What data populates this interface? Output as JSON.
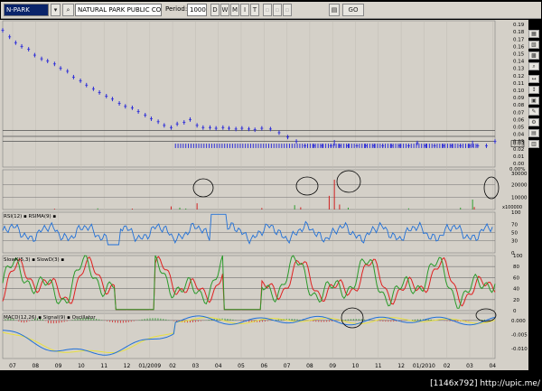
{
  "toolbar": {
    "ticker": "N-PARK",
    "company": "NATURAL PARK PUBLIC CO.",
    "period_label": "Period:",
    "period_value": "1000",
    "tf_buttons": [
      "D",
      "W",
      "M",
      "I",
      "T"
    ],
    "go_label": "GO"
  },
  "colors": {
    "background": "#d4d0c8",
    "price": "#2a2ad8",
    "grid": "#505050",
    "volume": "#2e9e2e",
    "volume_alt": "#d02020",
    "rsi": "#2070d8",
    "stoch_k": "#2a9a2a",
    "stoch_d": "#e02020",
    "macd": "#2070d8",
    "signal": "#e8e040",
    "osc_pos": "#3ea03e",
    "osc_neg": "#d04040"
  },
  "credit": "[1146x792] http://upic.me/",
  "chart_data": [
    {
      "type": "line",
      "subtype": "ohlc",
      "panel": "price",
      "y_ticks": [
        0.19,
        0.18,
        0.17,
        0.16,
        0.15,
        0.14,
        0.13,
        0.12,
        0.11,
        0.1,
        0.09,
        0.08,
        0.07,
        0.06,
        0.05,
        0.04,
        0.03,
        0.02,
        0.01,
        0.0
      ],
      "y_tick_labels": [
        "0.19",
        "0.18",
        "0.17",
        "0.16",
        "0.15",
        "0.14",
        "0.13",
        "0.12",
        "0.11",
        "0.10",
        "0.09",
        "0.08",
        "0.07",
        "0.06",
        "0.05",
        "0.04",
        "0.03",
        "0.02",
        "0.01",
        "0.00"
      ],
      "last_label": "0.03",
      "pct_label": "0.00%",
      "ylim": [
        -0.005,
        0.195
      ],
      "horizontal_lines": [
        0.045,
        0.037,
        0.03
      ],
      "x": [
        0,
        8,
        15,
        22,
        30,
        37,
        45,
        52,
        60,
        67,
        75,
        82,
        90,
        97,
        105,
        112,
        120,
        127,
        135,
        142,
        150,
        157,
        165,
        172,
        180,
        187,
        195,
        202,
        210,
        217,
        225,
        232,
        240,
        247,
        255,
        262,
        270,
        277,
        285,
        292,
        300,
        310,
        320,
        330,
        340,
        350,
        360,
        370,
        380,
        390,
        400,
        410,
        420,
        430,
        440,
        450,
        460,
        470,
        480,
        490,
        500,
        510,
        520,
        530,
        540,
        550,
        560,
        570
      ],
      "close": [
        0.182,
        0.173,
        0.165,
        0.16,
        0.156,
        0.148,
        0.143,
        0.14,
        0.136,
        0.13,
        0.126,
        0.118,
        0.113,
        0.107,
        0.102,
        0.097,
        0.092,
        0.088,
        0.082,
        0.078,
        0.076,
        0.071,
        0.066,
        0.061,
        0.057,
        0.052,
        0.049,
        0.054,
        0.056,
        0.06,
        0.052,
        0.049,
        0.049,
        0.048,
        0.049,
        0.048,
        0.047,
        0.048,
        0.047,
        0.046,
        0.048,
        0.047,
        0.042,
        0.036,
        0.03,
        0.024,
        0.024,
        0.024,
        0.024,
        0.024,
        0.024,
        0.024,
        0.024,
        0.024,
        0.024,
        0.024,
        0.024,
        0.024,
        0.028,
        0.024,
        0.024,
        0.024,
        0.024,
        0.024,
        0.024,
        0.024,
        0.024,
        0.03
      ]
    },
    {
      "type": "bar",
      "panel": "volume",
      "y_tick_labels": [
        "30000",
        "20000",
        "10000",
        "x100000"
      ],
      "ylim": [
        0,
        32000
      ]
    },
    {
      "type": "line",
      "panel": "rsi",
      "legend": [
        "RSI(12)",
        "RSIMA(9)"
      ],
      "y_tick_labels": [
        "100",
        "70",
        "50",
        "30",
        "0"
      ],
      "ylim": [
        0,
        100
      ]
    },
    {
      "type": "line",
      "panel": "stochastic",
      "legend": [
        "SlowK(5,3)",
        "SlowD(3)"
      ],
      "y_tick_labels": [
        "100",
        "80",
        "60",
        "40",
        "20",
        "0"
      ],
      "ylim": [
        0,
        100
      ]
    },
    {
      "type": "line",
      "panel": "macd",
      "legend": [
        "MACD(12,26)",
        "Signal(9)",
        "Oscillator"
      ],
      "y_tick_labels": [
        "0.000",
        "-0.005",
        "-0.010"
      ],
      "ylim": [
        -0.0135,
        0.0025
      ]
    }
  ],
  "x_axis": {
    "labels": [
      "07",
      "08",
      "09",
      "10",
      "11",
      "12",
      "01/2009",
      "02",
      "03",
      "04",
      "05",
      "06",
      "07",
      "08",
      "09",
      "10",
      "11",
      "12",
      "01/2010",
      "02",
      "03",
      "04"
    ]
  }
}
